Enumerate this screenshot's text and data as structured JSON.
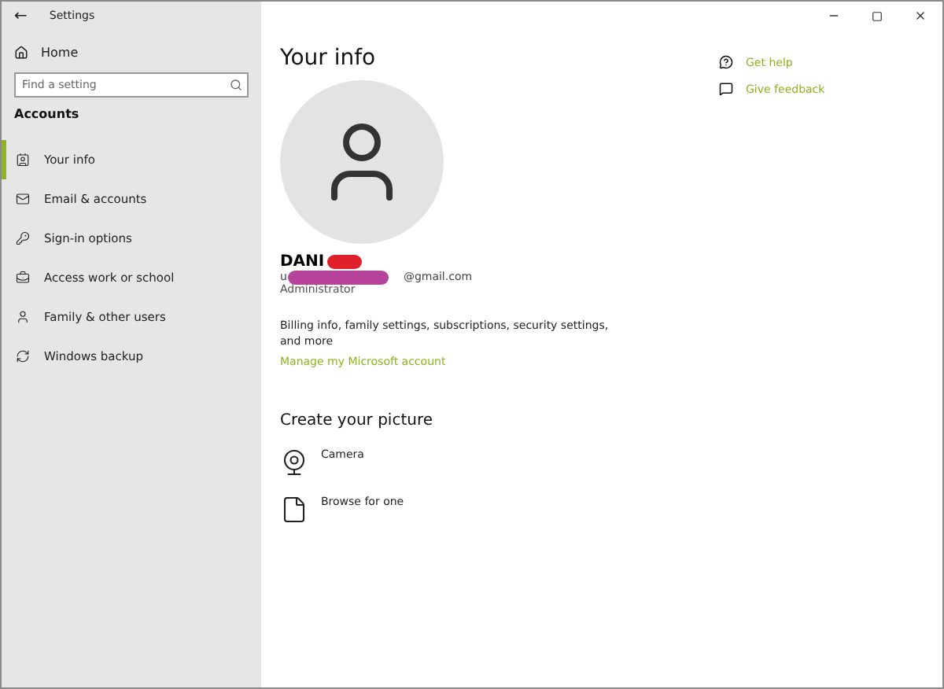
{
  "window": {
    "title": "Settings",
    "back": "←"
  },
  "sidebar": {
    "home": "Home",
    "search": {
      "placeholder": "Find a setting"
    },
    "section": "Accounts",
    "items": [
      {
        "label": "Your info",
        "selected": true
      },
      {
        "label": "Email & accounts",
        "selected": false
      },
      {
        "label": "Sign-in options",
        "selected": false
      },
      {
        "label": "Access work or school",
        "selected": false
      },
      {
        "label": "Family & other users",
        "selected": false
      },
      {
        "label": "Windows backup",
        "selected": false
      }
    ]
  },
  "main": {
    "title": "Your info",
    "name": "DANI",
    "email_start": "u",
    "email_end": "@gmail.com",
    "role": "Administrator",
    "billing": "Billing info, family settings, subscriptions, security settings, and more",
    "manage_link": "Manage my Microsoft account",
    "picture_heading": "Create your picture",
    "picture_options": [
      {
        "label": "Camera"
      },
      {
        "label": "Browse for one"
      }
    ]
  },
  "help": [
    {
      "label": "Get help"
    },
    {
      "label": "Give feedback"
    }
  ]
}
